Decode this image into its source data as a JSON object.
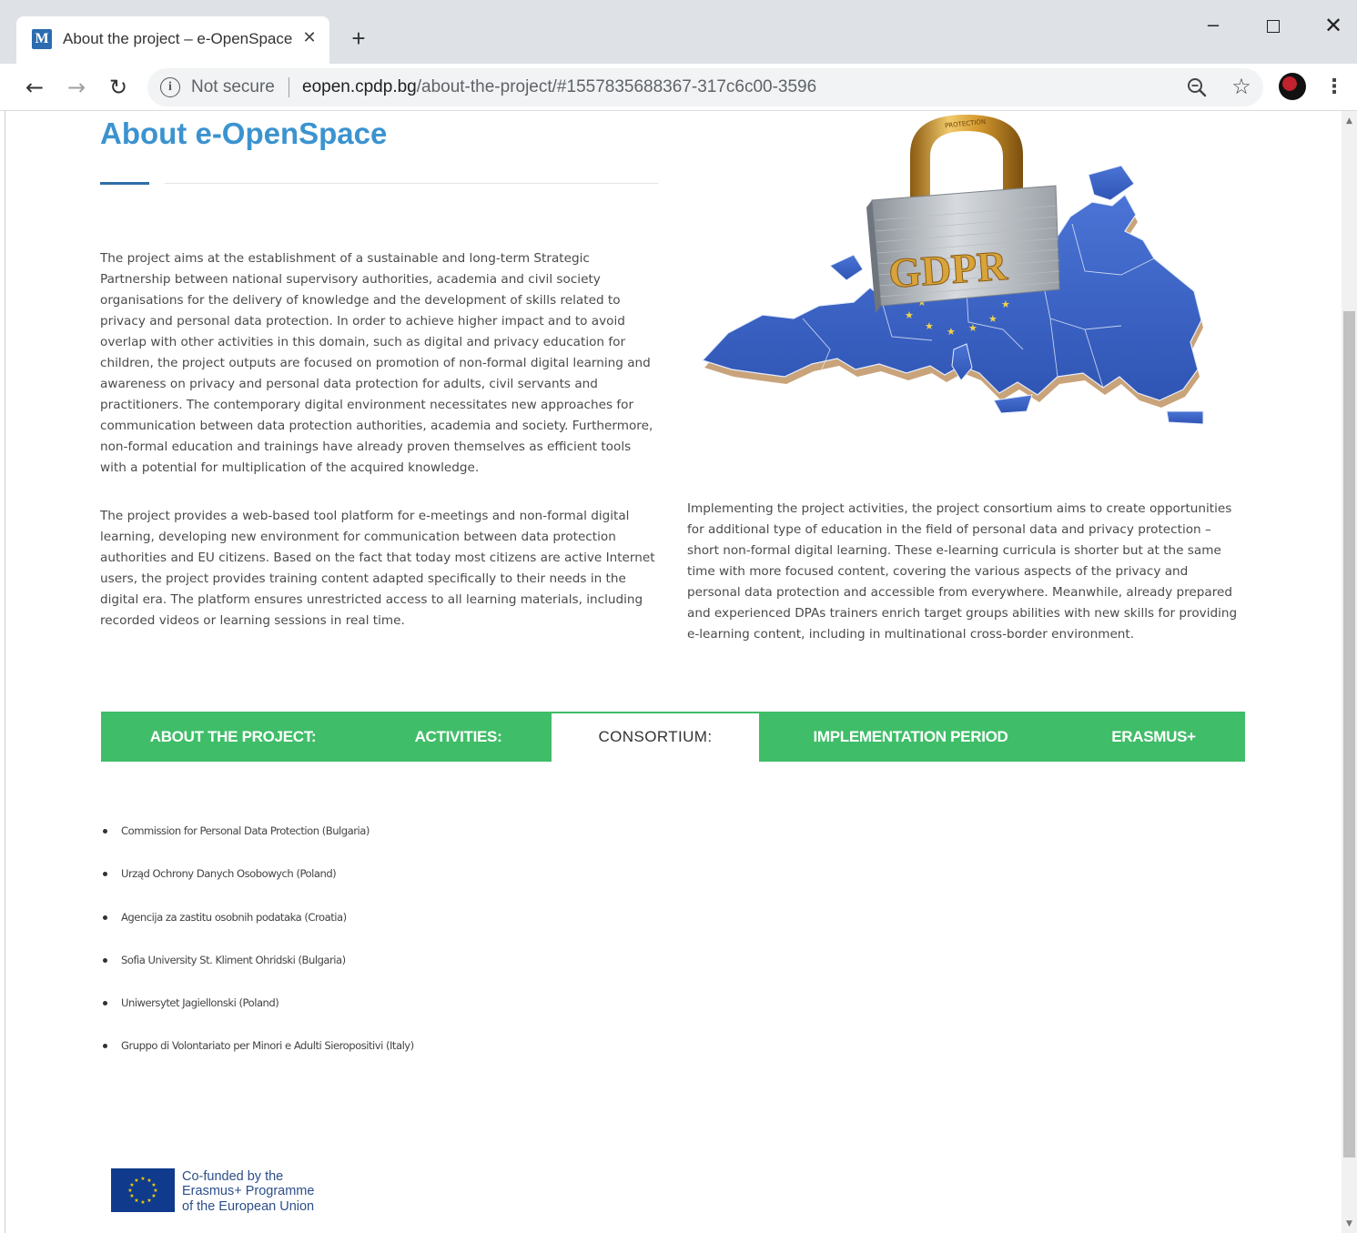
{
  "browser": {
    "tab_title": "About the project – e-OpenSpace",
    "favicon_letter": "M",
    "tab_close_glyph": "✕",
    "new_tab_glyph": "+",
    "window_controls": {
      "minimize": "–",
      "close": "✕"
    },
    "nav": {
      "back": "←",
      "forward": "→",
      "reload": "↻"
    },
    "security_label": "Not secure",
    "url_domain": "eopen.cpdp.bg",
    "url_path": "/about-the-project/#1557835688367-317c6c00-3596",
    "star_glyph": "☆",
    "menu_glyph": "⋮"
  },
  "page": {
    "title": "About e-OpenSpace",
    "paragraphs": [
      "The project aims at the establishment of a sustainable and long-term Strategic Partnership between national supervisory authorities, academia and civil society organisations for the delivery of knowledge and the development of skills related to privacy and personal data protection. In order to achieve higher impact and to avoid overlap with other activities in this domain, such as digital and privacy education for children, the project outputs are focused on promotion of non-formal digital learning and awareness on privacy and personal data protection for adults, civil servants and practitioners. The contemporary digital environment necessitates new approaches for communication between data protection authorities, academia and society. Furthermore, non-formal education and trainings have already proven themselves as efficient tools with a potential for multiplication of the acquired knowledge.",
      "The project provides a web-based tool platform for e-meetings and non-formal digital learning, developing new environment for communication between data protection authorities and EU citizens. Based on the fact that today most citizens are active Internet users, the project provides training content adapted specifically to their needs in the digital era. The platform ensures unrestricted access to all learning materials, including recorded videos or learning sessions in real time.",
      "Implementing the project activities, the project consortium aims to create opportunities for additional type of education in the field of personal data and privacy protection – short non-formal digital learning. These e-learning curricula is shorter but at the same time with more focused content, covering the various aspects of the privacy and personal data protection and accessible from everywhere. Meanwhile, already prepared and experienced DPAs trainers enrich target groups abilities with new skills for providing e-learning content, including in multinational cross-border environment."
    ],
    "image": {
      "lock_text": "GDPR",
      "shackle_text": "PROTECTION"
    },
    "tabs": [
      {
        "label": "ABOUT THE PROJECT:",
        "active": false
      },
      {
        "label": "ACTIVITIES:",
        "active": false
      },
      {
        "label": "CONSORTIUM:",
        "active": true
      },
      {
        "label": "IMPLEMENTATION PERIOD",
        "active": false
      },
      {
        "label": "ERASMUS+",
        "active": false
      }
    ],
    "partners": [
      "Commission for Personal Data Protection (Bulgaria)",
      "Urząd Ochrony Danych Osobowych (Poland)",
      "Agencija za zastitu osobnih podataka (Croatia)",
      "Sofia University St. Kliment Ohridski (Bulgaria)",
      "Uniwersytet Jagiellonski (Poland)",
      "Gruppo di Volontariato per Minori e Adulti Sieropositivi (Italy)"
    ],
    "footer_logo": {
      "line1": "Co-funded by the",
      "line2": "Erasmus+ Programme",
      "line3": "of the European Union"
    }
  },
  "colors": {
    "title_blue": "#3b93cf",
    "tab_green": "#3fbd68",
    "eu_blue": "#103b8c",
    "map_blue": "#3a63c4"
  }
}
